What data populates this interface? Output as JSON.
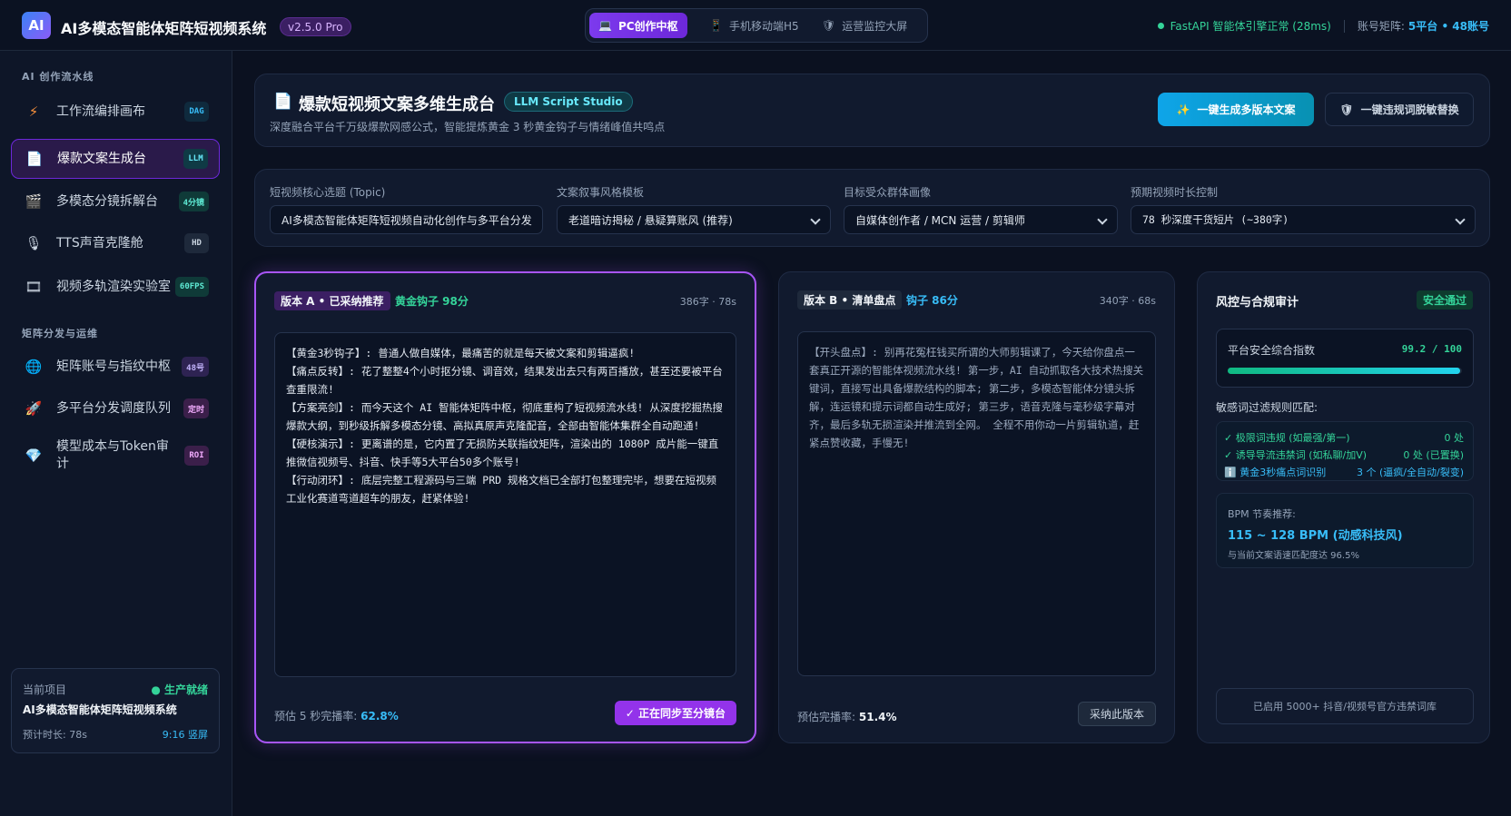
{
  "app": {
    "logo": "AI",
    "title": "AI多模态智能体矩阵短视频系统",
    "version": "v2.5.0 Pro"
  },
  "modes": [
    {
      "label": "PC创作中枢",
      "icon": "monitor-icon",
      "glyph": "💻",
      "active": true
    },
    {
      "label": "手机移动端H5",
      "icon": "mobile-icon",
      "glyph": "📱",
      "active": false
    },
    {
      "label": "运营监控大屏",
      "icon": "shield-icon",
      "glyph": "🛡",
      "active": false
    }
  ],
  "status": {
    "engine": "FastAPI 智能体引擎正常 (28ms)",
    "account_label": "账号矩阵:",
    "account_value": "5平台 • 48账号"
  },
  "sidebar": {
    "section1": "AI 创作流水线",
    "section2": "矩阵分发与运维",
    "items": [
      {
        "label": "工作流编排画布",
        "icon": "lightning-icon",
        "glyph": "⚡",
        "tag": "DAG",
        "tag_color": "#38bdf8",
        "tag_bg": "#0f2a3d",
        "active": false
      },
      {
        "label": "爆款文案生成台",
        "icon": "document-icon",
        "glyph": "📄",
        "tag": "LLM",
        "tag_color": "#67e8f9",
        "tag_bg": "#0f3a45",
        "active": true
      },
      {
        "label": "多模态分镜拆解台",
        "icon": "clapperboard-icon",
        "glyph": "🎬",
        "tag": "4分镜",
        "tag_color": "#5eead4",
        "tag_bg": "#0f3a38",
        "active": false
      },
      {
        "label": "TTS声音克隆舱",
        "icon": "microphone-icon",
        "glyph": "🎙",
        "tag": "HD",
        "tag_color": "#cbd5e1",
        "tag_bg": "#1e293b",
        "active": false
      },
      {
        "label": "视频多轨渲染实验室",
        "icon": "film-icon",
        "glyph": "🎞",
        "tag": "60FPS",
        "tag_color": "#5eead4",
        "tag_bg": "#0f3a38",
        "active": false
      },
      {
        "label": "矩阵账号与指纹中枢",
        "icon": "globe-icon",
        "glyph": "🌐",
        "tag": "48号",
        "tag_color": "#c4b5fd",
        "tag_bg": "#2e2352",
        "active": false
      },
      {
        "label": "多平台分发调度队列",
        "icon": "rocket-icon",
        "glyph": "🚀",
        "tag": "定时",
        "tag_color": "#f0abfc",
        "tag_bg": "#3b1f4a",
        "active": false
      },
      {
        "label": "模型成本与Token审计",
        "icon": "diamond-icon",
        "glyph": "💎",
        "tag": "ROI",
        "tag_color": "#f0abfc",
        "tag_bg": "#3b1f4a",
        "active": false
      }
    ],
    "project": {
      "label": "当前项目",
      "status": "● 生产就绪",
      "name": "AI多模态智能体矩阵短视频系统",
      "duration": "预计时长: 78s",
      "ratio": "9:16 竖屏"
    }
  },
  "header": {
    "icon": "document-icon",
    "title": "爆款短视频文案多维生成台",
    "badge": "LLM Script Studio",
    "subtitle": "深度融合平台千万级爆款网感公式，智能提炼黄金 3 秒黄金钩子与情绪峰值共鸣点",
    "primary_btn": "一键生成多版本文案",
    "primary_icon": "sparkle-icon",
    "secondary_btn": "一键违规词脱敏替换",
    "secondary_icon": "shield-icon"
  },
  "form": {
    "topic_label": "短视频核心选题 (Topic)",
    "topic_value": "AI多模态智能体矩阵短视频自动化创作与多平台分发",
    "style_label": "文案叙事风格模板",
    "style_value": "老道暗访揭秘 / 悬疑算账风 (推荐)",
    "audience_label": "目标受众群体画像",
    "audience_value": "自媒体创作者 / MCN 运营 / 剪辑师",
    "length_label": "预期视频时长控制",
    "length_value": "78 秒深度干货短片 (~380字)"
  },
  "version_a": {
    "tag": "版本 A • 已采纳推荐",
    "hook": "黄金钩子 98分",
    "meta": "386字 · 78s",
    "lines": [
      "【黄金3秒钩子】: 普通人做自媒体，最痛苦的就是每天被文案和剪辑逼疯!",
      "【痛点反转】: 花了整整4个小时抠分镜、调音效，结果发出去只有两百播放，甚至还要被平台查重限流!",
      "【方案亮剑】: 而今天这个 AI 智能体矩阵中枢，彻底重构了短视频流水线! 从深度挖掘热搜爆款大纲，到秒级拆解多模态分镜、高拟真原声克隆配音，全部由智能体集群全自动跑通!",
      "【硬核演示】: 更离谱的是，它内置了无损防关联指纹矩阵，渲染出的 1080P 成片能一键直推微信视频号、抖音、快手等5大平台50多个账号!",
      "【行动闭环】: 底层完整工程源码与三端 PRD 规格文档已全部打包整理完毕，想要在短视频工业化赛道弯道超车的朋友，赶紧体验!"
    ],
    "foot_label": "预估 5 秒完播率:",
    "foot_value": "62.8%",
    "button": "✓ 正在同步至分镜台"
  },
  "version_b": {
    "tag": "版本 B • 清单盘点",
    "hook": "钩子 86分",
    "meta": "340字 · 68s",
    "lines": [
      "【开头盘点】: 别再花冤枉钱买所谓的大师剪辑课了，今天给你盘点一套真正开源的智能体视频流水线! 第一步，AI 自动抓取各大技术热搜关键词，直接写出具备爆款结构的脚本; 第二步，多模态智能体分镜头拆解，连运镜和提示词都自动生成好; 第三步，语音克隆与毫秒级字幕对齐，最后多轨无损渲染并推流到全网。 全程不用你动一片剪辑轨道，赶紧点赞收藏，手慢无!"
    ],
    "foot_label": "预估完播率:",
    "foot_value": "51.4%",
    "button": "采纳此版本"
  },
  "risk": {
    "title": "风控与合规审计",
    "pass": "安全通过",
    "score_label": "平台安全综合指数",
    "score_value": "99.2 / 100",
    "score_fraction": 0.992,
    "rules_title": "敏感词过滤规则匹配:",
    "rules": [
      {
        "label": "✓ 极限词违规 (如最强/第一)",
        "value": "0 处",
        "color": "#34d399",
        "value_color": "#34d399",
        "icon": "check-icon"
      },
      {
        "label": "✓ 诱导导流违禁词 (如私聊/加V)",
        "value": "0 处 (已置换)",
        "color": "#34d399",
        "value_color": "#34d399",
        "icon": "check-icon"
      },
      {
        "label": "ℹ️ 黄金3秒痛点词识别",
        "value": "3 个 (逼疯/全自动/裂变)",
        "color": "#38bdf8",
        "value_color": "#38bdf8",
        "icon": "info-icon"
      }
    ],
    "bpm_label": "BPM 节奏推荐:",
    "bpm_value": "115 ~ 128 BPM (动感科技风)",
    "bpm_note": "与当前文案语速匹配度达 96.5%",
    "library": "已启用 5000+ 抖音/视频号官方违禁词库"
  }
}
